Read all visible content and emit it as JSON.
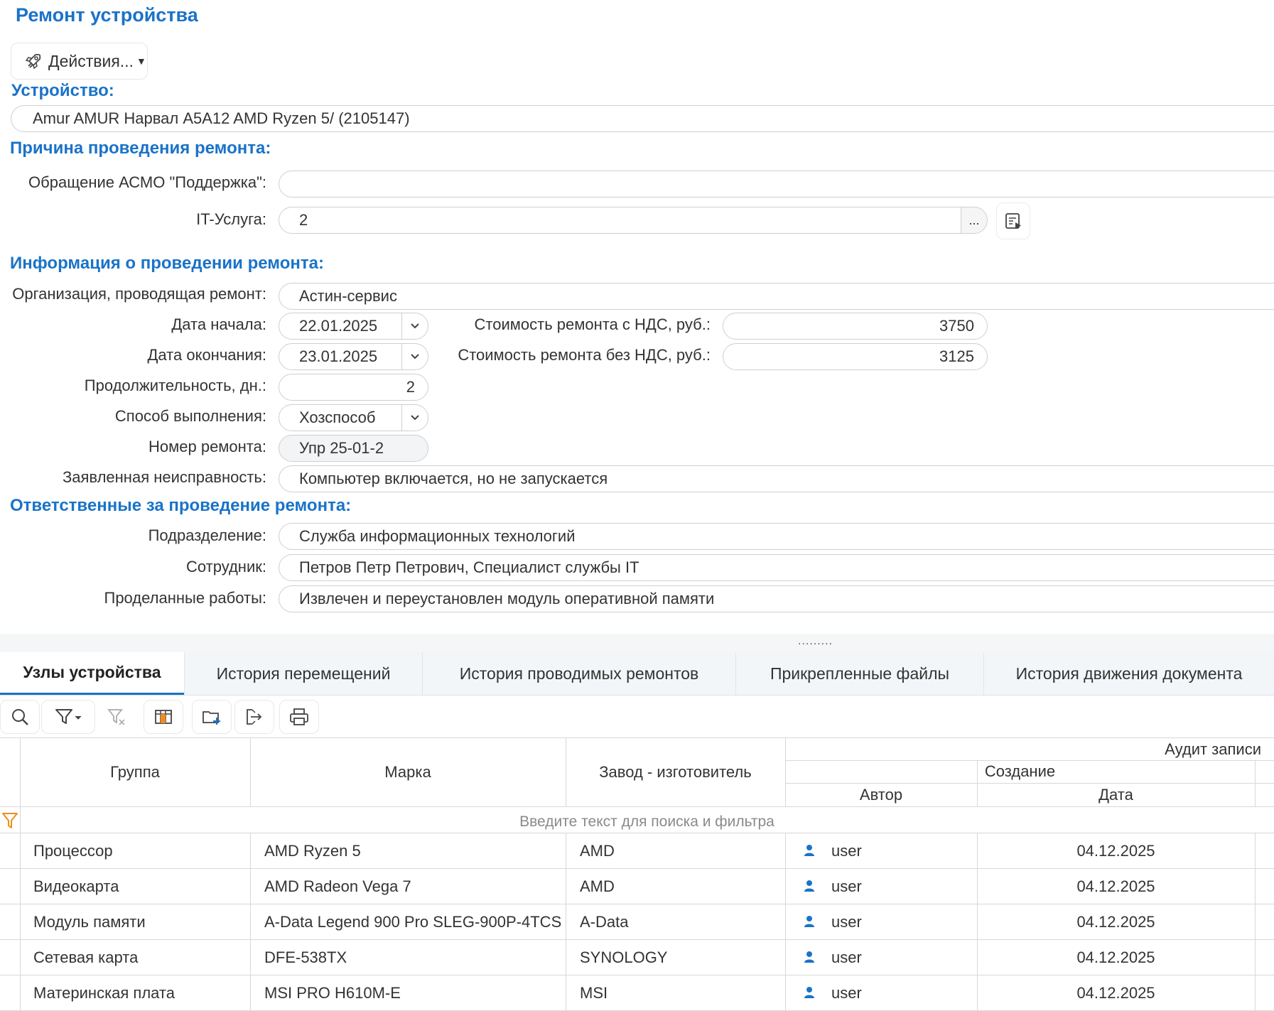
{
  "page": {
    "title": "Ремонт устройства"
  },
  "actions": {
    "label": "Действия..."
  },
  "sections": {
    "device": "Устройство:",
    "reason": "Причина проведения ремонта:",
    "info": "Информация о проведении ремонта:",
    "responsible": "Ответственные за проведение ремонта:"
  },
  "device": {
    "value": "Amur AMUR Нарвал A5A12 AMD Ryzen 5/ (2105147)"
  },
  "reason": {
    "appeal_label": "Обращение АСМО \"Поддержка\":",
    "appeal_value": "",
    "it_service_label": "IT-Услуга:",
    "it_service_value": "2",
    "dots": "..."
  },
  "info": {
    "org_label": "Организация, проводящая ремонт:",
    "org_value": "Астин-сервис",
    "start_label": "Дата начала:",
    "start_value": "22.01.2025",
    "end_label": "Дата окончания:",
    "end_value": "23.01.2025",
    "cost_vat_label": "Стоимость ремонта с НДС, руб.:",
    "cost_vat_value": "3750",
    "cost_novat_label": "Стоимость ремонта без НДС, руб.:",
    "cost_novat_value": "3125",
    "duration_label": "Продолжительность, дн.:",
    "duration_value": "2",
    "method_label": "Способ выполнения:",
    "method_value": "Хозспособ",
    "number_label": "Номер ремонта:",
    "number_value": "Упр 25-01-2",
    "fault_label": "Заявленная неисправность:",
    "fault_value": "Компьютер включается, но не запускается"
  },
  "responsible": {
    "dept_label": "Подразделение:",
    "dept_value": "Служба информационных технологий",
    "employee_label": "Сотрудник:",
    "employee_value": "Петров Петр Петрович, Специалист службы IT",
    "works_label": "Проделанные работы:",
    "works_value": "Извлечен и переустановлен модуль оперативной памяти"
  },
  "splitter": {
    "grip": "........."
  },
  "tabs": [
    {
      "label": "Узлы устройства"
    },
    {
      "label": "История перемещений"
    },
    {
      "label": "История проводимых ремонтов"
    },
    {
      "label": "Прикрепленные файлы"
    },
    {
      "label": "История движения документа"
    }
  ],
  "grid": {
    "headers": {
      "group": "Группа",
      "brand": "Марка",
      "maker": "Завод - изготовитель",
      "audit": "Аудит записи",
      "creation": "Создание",
      "author": "Автор",
      "date": "Дата"
    },
    "filter_placeholder": "Введите текст для поиска и фильтра",
    "rows": [
      {
        "group": "Процессор",
        "brand": "AMD Ryzen 5",
        "maker": "AMD",
        "author": "user",
        "date": "04.12.2025"
      },
      {
        "group": "Видеокарта",
        "brand": "AMD Radeon Vega 7",
        "maker": "AMD",
        "author": "user",
        "date": "04.12.2025"
      },
      {
        "group": "Модуль памяти",
        "brand": "A-Data Legend 900 Pro SLEG-900P-4TCS",
        "maker": "A-Data",
        "author": "user",
        "date": "04.12.2025"
      },
      {
        "group": "Сетевая карта",
        "brand": "DFE-538TX",
        "maker": "SYNOLOGY",
        "author": "user",
        "date": "04.12.2025"
      },
      {
        "group": "Материнская плата",
        "brand": "MSI PRO H610M-E",
        "maker": "MSI",
        "author": "user",
        "date": "04.12.2025"
      }
    ]
  },
  "colors": {
    "accent": "#1a73c8",
    "filter_icon": "#f08c1e",
    "user_icon": "#1a73c8"
  }
}
